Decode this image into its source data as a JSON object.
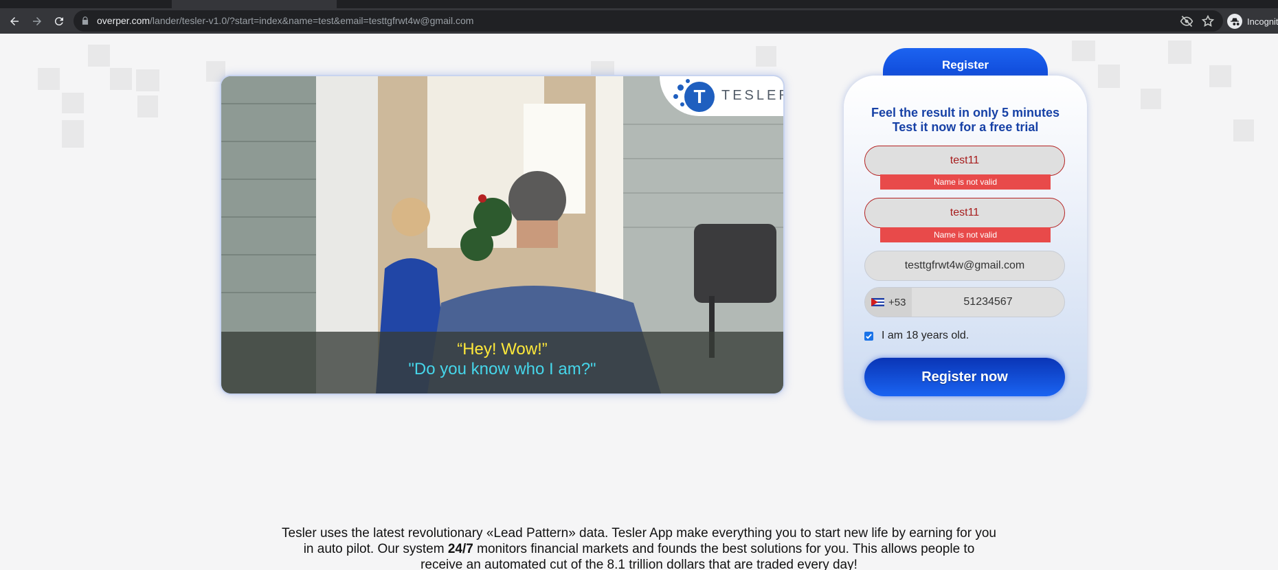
{
  "browser": {
    "url_host": "overper.com",
    "url_path": "/lander/tesler-v1.0/?start=index&name=test&email=testtgfrwt4w@gmail.com",
    "incognito_label": "Incognito"
  },
  "video": {
    "logo_letter": "T",
    "logo_text": "TESLER",
    "subtitle_line1": "“Hey! Wow!”",
    "subtitle_line2": "\"Do you know who I am?\""
  },
  "form": {
    "tab_label": "Register",
    "headline_line1": "Feel the result in only 5 minutes",
    "headline_line2": "Test it now for a free trial",
    "first_name_value": "test11",
    "first_name_error": "Name is not valid",
    "last_name_value": "test11",
    "last_name_error": "Name is not valid",
    "email_value": "testtgfrwt4w@gmail.com",
    "phone_code": "+53",
    "phone_value": "51234567",
    "age_label": "I am 18 years old.",
    "age_checked": true,
    "submit_label": "Register now"
  },
  "description": {
    "part1": "Tesler uses the latest revolutionary «Lead Pattern» data. Tesler App make everything you to start new life by earning for you in auto pilot. Our system ",
    "bold": "24/7",
    "part2": " monitors financial markets and founds the best solutions for you. This allows people to receive an automated cut of the 8.1 trillion dollars that are traded every day!"
  },
  "colors": {
    "accent": "#1a55e0",
    "headline": "#1741a6",
    "error": "#e84a4a"
  }
}
